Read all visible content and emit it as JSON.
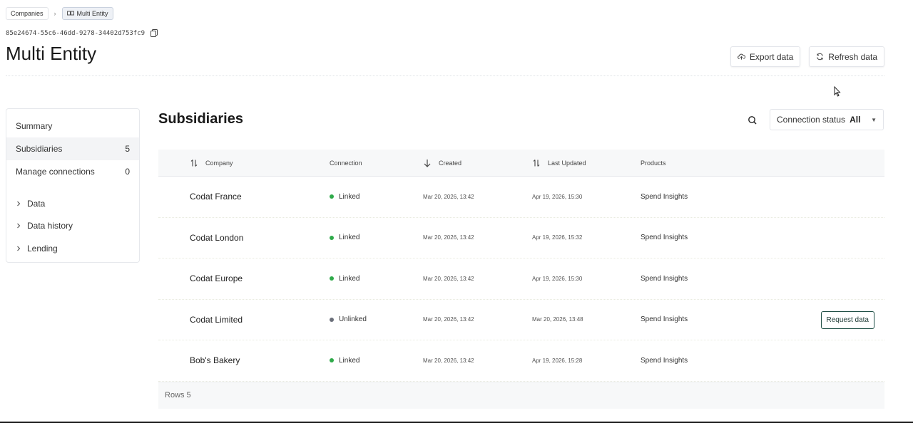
{
  "breadcrumb": {
    "root": "Companies",
    "separator": "›",
    "current": "Multi Entity"
  },
  "company_id": "85e24674-55c6-46dd-9278-34402d753fc9",
  "page_title": "Multi Entity",
  "header_actions": {
    "export_label": "Export data",
    "refresh_label": "Refresh data"
  },
  "sidebar": {
    "items": [
      {
        "label": "Summary",
        "count": ""
      },
      {
        "label": "Subsidiaries",
        "count": "5"
      },
      {
        "label": "Manage connections",
        "count": "0"
      }
    ],
    "groups": [
      {
        "label": "Data"
      },
      {
        "label": "Data history"
      },
      {
        "label": "Lending"
      }
    ]
  },
  "subsidiaries": {
    "title": "Subsidiaries",
    "filter_label": "Connection status",
    "filter_value": "All",
    "columns": {
      "company": "Company",
      "connection": "Connection",
      "created": "Created",
      "updated": "Last Updated",
      "products": "Products"
    },
    "rows": [
      {
        "company": "Codat France",
        "connection": "Linked",
        "created": "Mar 20, 2026, 13:42",
        "updated": "Apr 19, 2026, 15:30",
        "products": "Spend Insights"
      },
      {
        "company": "Codat London",
        "connection": "Linked",
        "created": "Mar 20, 2026, 13:42",
        "updated": "Apr 19, 2026, 15:32",
        "products": "Spend Insights"
      },
      {
        "company": "Codat Europe",
        "connection": "Linked",
        "created": "Mar 20, 2026, 13:42",
        "updated": "Apr 19, 2026, 15:30",
        "products": "Spend Insights"
      },
      {
        "company": "Codat Limited",
        "connection": "Unlinked",
        "created": "Mar 20, 2026, 13:42",
        "updated": "Mar 20, 2026, 13:48",
        "products": "Spend Insights",
        "action": "Request data"
      },
      {
        "company": "Bob's Bakery",
        "connection": "Linked",
        "created": "Mar 20, 2026, 13:42",
        "updated": "Apr 19, 2026, 15:28",
        "products": "Spend Insights"
      }
    ],
    "footer": "Rows 5"
  },
  "colors": {
    "linked": "#2faa4a",
    "unlinked": "#6b6f7a",
    "request_border": "#1f4f45"
  },
  "icons": {
    "copy": "copy-icon",
    "export": "cloud-upload-icon",
    "refresh": "refresh-icon",
    "search": "search-icon",
    "sort": "sort-icon",
    "sort_desc": "arrow-down-icon",
    "chevron": "chevron-right-icon"
  }
}
